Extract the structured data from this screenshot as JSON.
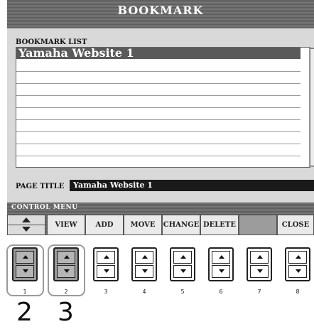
{
  "screen": {
    "title": "BOOKMARK",
    "list_label": "BOOKMARK LIST",
    "list_items": [
      "Yamaha Website 1"
    ],
    "page_title_label": "PAGE TITLE",
    "page_title_value": "Yamaha Website 1"
  },
  "control_menu": {
    "label": "CONTROL MENU",
    "buttons": [
      {
        "label": "VIEW"
      },
      {
        "label": "ADD"
      },
      {
        "label": "MOVE"
      },
      {
        "label": "CHANGE"
      },
      {
        "label": "DELETE"
      },
      {
        "label": ""
      },
      {
        "label": "CLOSE"
      }
    ]
  },
  "hardware_buttons": [
    {
      "number": "1",
      "highlighted": true
    },
    {
      "number": "2",
      "highlighted": true
    },
    {
      "number": "3",
      "highlighted": false
    },
    {
      "number": "4",
      "highlighted": false
    },
    {
      "number": "5",
      "highlighted": false
    },
    {
      "number": "6",
      "highlighted": false
    },
    {
      "number": "7",
      "highlighted": false
    },
    {
      "number": "8",
      "highlighted": false
    }
  ],
  "step_labels": [
    "2",
    "3"
  ],
  "colors": {
    "lcd_background": "#d9d9d9",
    "header_bar": "#666666",
    "selected_row": "#5a5a5a",
    "page_title_field": "#1a1a1a",
    "highlight_outline": "#9a9a9a"
  }
}
